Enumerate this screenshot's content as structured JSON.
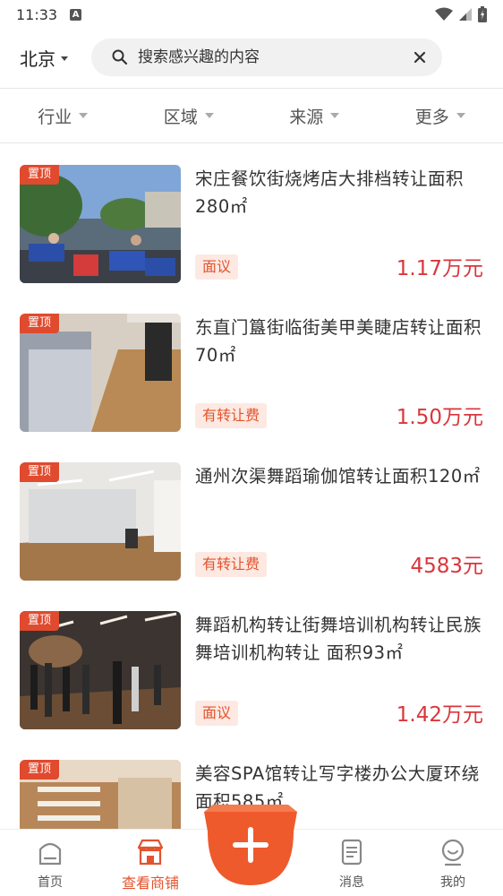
{
  "status_bar": {
    "time": "11:33",
    "a_badge": "A"
  },
  "header": {
    "city": "北京",
    "search_placeholder": "搜索感兴趣的内容"
  },
  "filters": [
    "行业",
    "区域",
    "来源",
    "更多"
  ],
  "listings": [
    {
      "badge": "置顶",
      "title": "宋庄餐饮街烧烤店大排档转让面积280㎡",
      "tag": "面议",
      "price": "1.17万元"
    },
    {
      "badge": "置顶",
      "title": "东直门簋街临街美甲美睫店转让面积70㎡",
      "tag": "有转让费",
      "price": "1.50万元"
    },
    {
      "badge": "置顶",
      "title": "通州次渠舞蹈瑜伽馆转让面积120㎡",
      "tag": "有转让费",
      "price": "4583元"
    },
    {
      "badge": "置顶",
      "title": "舞蹈机构转让街舞培训机构转让民族舞培训机构转让 面积93㎡",
      "tag": "面议",
      "price": "1.42万元"
    },
    {
      "badge": "置顶",
      "title": "美容SPA馆转让写字楼办公大厦环绕 面积585㎡",
      "tag": "",
      "price": ""
    }
  ],
  "nav": {
    "home": "首页",
    "shops": "查看商铺",
    "messages": "消息",
    "mine": "我的"
  },
  "colors": {
    "accent": "#e2542e",
    "price": "#d9363b",
    "badge": "#e04a2e"
  }
}
